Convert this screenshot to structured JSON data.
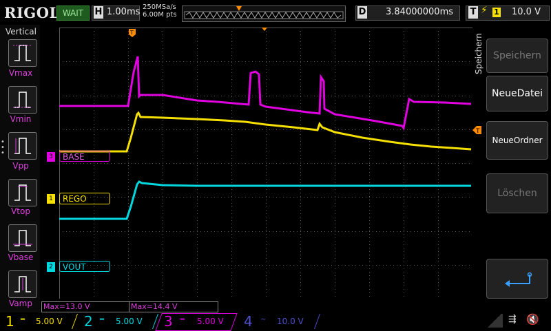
{
  "topbar": {
    "logo": "RIGOL",
    "run_status": "WAIT",
    "horiz_key": "H",
    "timebase": "1.00ms",
    "sample_rate": "250MSa/s",
    "mem_depth": "6.00M pts",
    "delay_key": "D",
    "delay_value": "3.84000000ms",
    "trigger_key": "T",
    "trigger_source": "1",
    "trigger_level": "10.0 V",
    "trigger_edge_icon": "rising-edge-icon"
  },
  "measure_panel": {
    "title": "Vertical",
    "items": [
      "Vmax",
      "Vmin",
      "Vpp",
      "Vtop",
      "Vbase",
      "Vamp"
    ]
  },
  "channel_labels": {
    "ch3": {
      "num": "3",
      "name": "BASE"
    },
    "ch1": {
      "num": "1",
      "name": "REGO"
    },
    "ch2": {
      "num": "2",
      "name": "VOUT"
    }
  },
  "right_menu": {
    "title": "Speichern",
    "buttons": [
      "Speichern",
      "NeueDatei",
      "NeueOrdner",
      "Löschen"
    ]
  },
  "measurements": {
    "m1": "Max=13.0 V",
    "m2": "Max=14.4 V"
  },
  "channels": [
    {
      "num": "1",
      "coupling": "DC",
      "scale": "5.00 V",
      "color": "#f5e000"
    },
    {
      "num": "2",
      "coupling": "DC",
      "scale": "5.00 V",
      "color": "#00d8e0"
    },
    {
      "num": "3",
      "coupling": "DC",
      "scale": "5.00 V",
      "color": "#e000e0"
    },
    {
      "num": "4",
      "coupling": "AC",
      "scale": "10.0 V",
      "color": "#5050d0"
    }
  ],
  "colors": {
    "ch1": "#f5e000",
    "ch2": "#00d8e0",
    "ch3": "#e000e0",
    "trigger": "#ff8c00",
    "grid": "#5a5a5a"
  }
}
